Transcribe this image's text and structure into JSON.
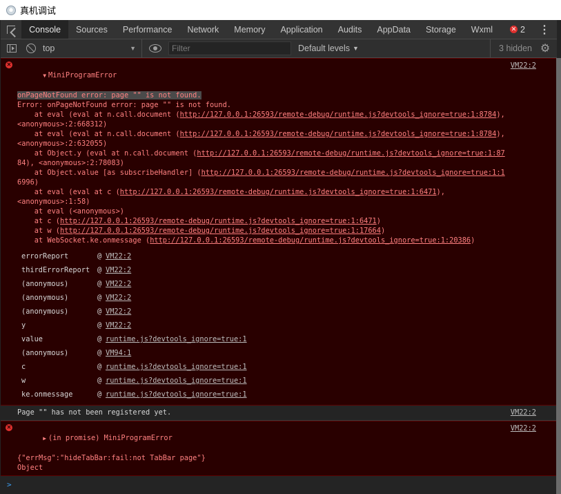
{
  "window": {
    "title": "真机调试"
  },
  "tabs": [
    "Console",
    "Sources",
    "Performance",
    "Network",
    "Memory",
    "Application",
    "Audits",
    "AppData",
    "Storage",
    "Wxml"
  ],
  "active_tab": "Console",
  "error_count": "2",
  "toolbar": {
    "context": "top",
    "filter_placeholder": "Filter",
    "levels": "Default levels",
    "hidden": "3 hidden"
  },
  "messages": {
    "error1": {
      "source": "VM22:2",
      "title": "MiniProgramError",
      "highlight": "onPageNotFound error: page \"\" is not found.",
      "lines": [
        "Error: onPageNotFound error: page \"\" is not found.",
        "    at eval (eval at n.call.document (http://127.0.0.1:26593/remote-debug/runtime.js?devtools_ignore=true:1:8784),",
        "<anonymous>:2:668312)",
        "    at eval (eval at n.call.document (http://127.0.0.1:26593/remote-debug/runtime.js?devtools_ignore=true:1:8784),",
        "<anonymous>:2:632055)",
        "    at Object.y (eval at n.call.document (http://127.0.0.1:26593/remote-debug/runtime.js?devtools_ignore=true:1:87",
        "84), <anonymous>:2:78083)",
        "    at Object.value [as subscribeHandler] (http://127.0.0.1:26593/remote-debug/runtime.js?devtools_ignore=true:1:1",
        "6996)",
        "    at eval (eval at c (http://127.0.0.1:26593/remote-debug/runtime.js?devtools_ignore=true:1:6471),",
        "<anonymous>:1:58)",
        "    at eval (<anonymous>)",
        "    at c (http://127.0.0.1:26593/remote-debug/runtime.js?devtools_ignore=true:1:6471)",
        "    at w (http://127.0.0.1:26593/remote-debug/runtime.js?devtools_ignore=true:1:17664)",
        "    at WebSocket.ke.onmessage (http://127.0.0.1:26593/remote-debug/runtime.js?devtools_ignore=true:1:20386)"
      ],
      "stack": [
        {
          "fn": "errorReport",
          "src": "VM22:2"
        },
        {
          "fn": "thirdErrorReport",
          "src": "VM22:2"
        },
        {
          "fn": "(anonymous)",
          "src": "VM22:2"
        },
        {
          "fn": "(anonymous)",
          "src": "VM22:2"
        },
        {
          "fn": "(anonymous)",
          "src": "VM22:2"
        },
        {
          "fn": "y",
          "src": "VM22:2"
        },
        {
          "fn": "value",
          "src": "runtime.js?devtools_ignore=true:1"
        },
        {
          "fn": "(anonymous)",
          "src": "VM94:1"
        },
        {
          "fn": "c",
          "src": "runtime.js?devtools_ignore=true:1"
        },
        {
          "fn": "w",
          "src": "runtime.js?devtools_ignore=true:1"
        },
        {
          "fn": "ke.onmessage",
          "src": "runtime.js?devtools_ignore=true:1"
        }
      ]
    },
    "info": {
      "text": "Page \"\" has not been registered yet.",
      "source": "VM22:2"
    },
    "error2": {
      "source": "VM22:2",
      "title": "(in promise) MiniProgramError",
      "lines": [
        "{\"errMsg\":\"hideTabBar:fail:not TabBar page\"}",
        "Object"
      ]
    }
  },
  "prompt_symbol": ">"
}
